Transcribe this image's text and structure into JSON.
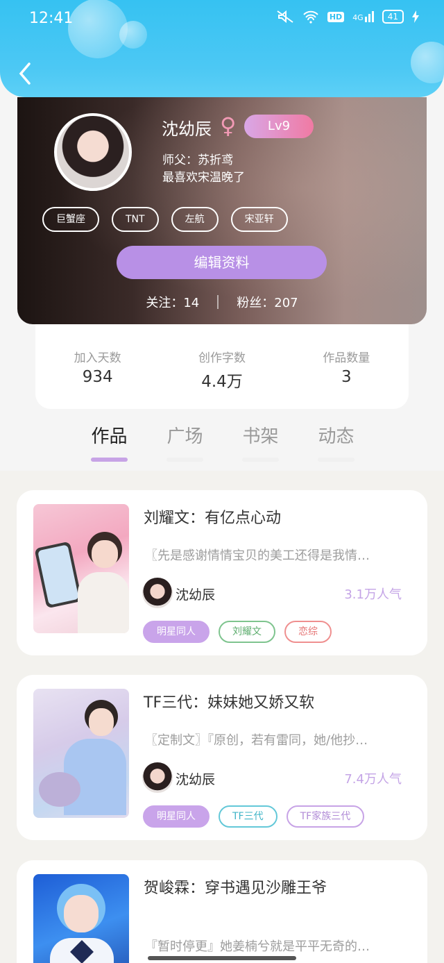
{
  "status_bar": {
    "time": "12:41",
    "network": "4G",
    "hd": "HD",
    "battery": "41"
  },
  "profile": {
    "name": "沈幼辰",
    "gender_symbol": "♀",
    "level": "Lv9",
    "master": "师父：苏折鸢",
    "favorite": "最喜欢宋温晚了",
    "tags": [
      "巨蟹座",
      "TNT",
      "左航",
      "宋亚轩"
    ],
    "edit_label": "编辑资料",
    "following_label": "关注：14",
    "fans_label": "粉丝：207"
  },
  "stats": [
    {
      "label": "加入天数",
      "value": "934"
    },
    {
      "label": "创作字数",
      "value": "4.4万"
    },
    {
      "label": "作品数量",
      "value": "3"
    }
  ],
  "tabs": [
    "作品",
    "广场",
    "书架",
    "动态"
  ],
  "works": [
    {
      "title": "刘耀文：有亿点心动",
      "desc": "〖先是感谢情情宝贝的美工还得是我情…",
      "author": "沈幼辰",
      "popularity": "3.1万人气",
      "tags": [
        {
          "label": "明星同人",
          "color": "#c9a4ea"
        },
        {
          "label": "刘耀文",
          "color": "#7ec48e"
        },
        {
          "label": "恋综",
          "color": "#ef8f8f"
        }
      ]
    },
    {
      "title": "TF三代：妹妹她又娇又软",
      "desc": "〖定制文〗『原创，若有雷同，她/他抄…",
      "author": "沈幼辰",
      "popularity": "7.4万人气",
      "tags": [
        {
          "label": "明星同人",
          "color": "#c9a4ea"
        },
        {
          "label": "TF三代",
          "color": "#63c8d8"
        },
        {
          "label": "TF家族三代",
          "color": "#c7a3e6"
        }
      ]
    },
    {
      "title": "贺峻霖：穿书遇见沙雕王爷",
      "desc": "『暂时停更』她姜楠兮就是平平无奇的…"
    }
  ],
  "colors": {
    "accent": "#36c2f2",
    "purple": "#b890e6"
  }
}
